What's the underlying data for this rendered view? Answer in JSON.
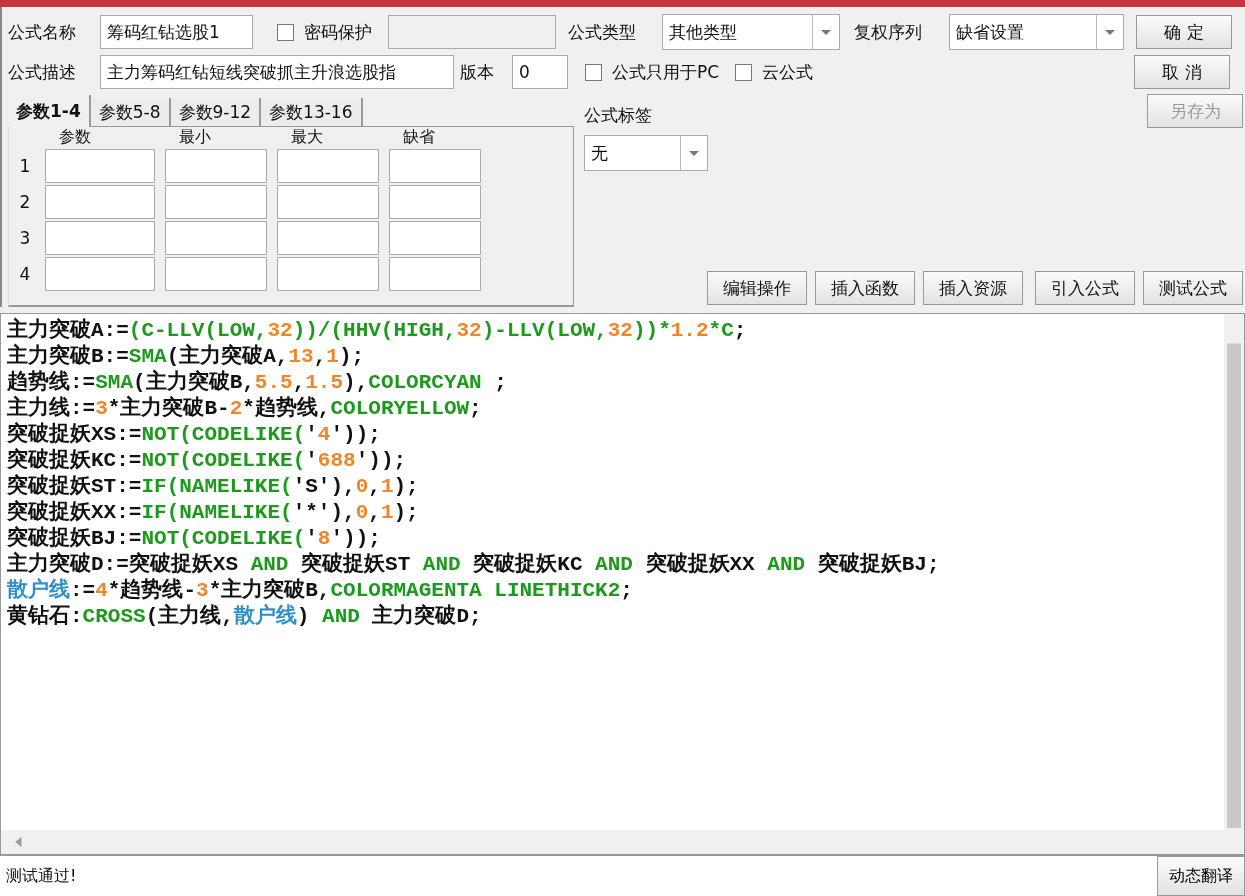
{
  "form": {
    "name_label": "公式名称",
    "name_value": "筹码红钻选股1",
    "password": {
      "label": "密码保护",
      "checked": false
    },
    "password_field": {
      "disabled": true
    },
    "desc_label": "公式描述",
    "desc_value": "主力筹码红钻短线突破抓主升浪选股指",
    "version_label": "版本",
    "version_value": "0",
    "type_label": "公式类型",
    "type_value": "其他类型",
    "rights_label": "复权序列",
    "rights_value": "缺省设置",
    "options": [
      {
        "label": "公式只用于PC",
        "checked": false
      },
      {
        "label": "云公式",
        "checked": false
      }
    ],
    "tag_label": "公式标签",
    "tag_value": "无"
  },
  "side_buttons": [
    {
      "label": "确 定",
      "disabled": false
    },
    {
      "label": "取 消",
      "disabled": false
    },
    {
      "label": "另存为",
      "disabled": true
    }
  ],
  "tabs": [
    {
      "label": "参数1-4",
      "selected": true
    },
    {
      "label": "参数5-8",
      "selected": false
    },
    {
      "label": "参数9-12",
      "selected": false
    },
    {
      "label": "参数13-16",
      "selected": false
    }
  ],
  "params": {
    "columns": [
      "参数",
      "最小",
      "最大",
      "缺省"
    ],
    "rows": [
      "1",
      "2",
      "3",
      "4"
    ]
  },
  "tool_buttons": [
    "编辑操作",
    "插入函数",
    "插入资源",
    "引入公式",
    "测试公式"
  ],
  "code": {
    "lines": [
      [
        {
          "text": "主力突破A:=",
          "kind": "text"
        },
        {
          "text": "(C-LLV(LOW,",
          "kind": "func"
        },
        {
          "text": "32",
          "kind": "num"
        },
        {
          "text": "))/(HHV(HIGH,",
          "kind": "func"
        },
        {
          "text": "32",
          "kind": "num"
        },
        {
          "text": ")-LLV(LOW,",
          "kind": "func"
        },
        {
          "text": "32",
          "kind": "num"
        },
        {
          "text": "))*",
          "kind": "func"
        },
        {
          "text": "1.2",
          "kind": "num"
        },
        {
          "text": "*C",
          "kind": "func"
        },
        {
          "text": ";",
          "kind": "text"
        }
      ],
      [
        {
          "text": "主力突破B:=",
          "kind": "text"
        },
        {
          "text": "SMA",
          "kind": "func"
        },
        {
          "text": "(主力突破A,",
          "kind": "text"
        },
        {
          "text": "13",
          "kind": "num"
        },
        {
          "text": ",",
          "kind": "text"
        },
        {
          "text": "1",
          "kind": "num"
        },
        {
          "text": ");",
          "kind": "text"
        }
      ],
      [
        {
          "text": "趋势线:=",
          "kind": "text"
        },
        {
          "text": "SMA",
          "kind": "func"
        },
        {
          "text": "(主力突破B,",
          "kind": "text"
        },
        {
          "text": "5.5",
          "kind": "num"
        },
        {
          "text": ",",
          "kind": "text"
        },
        {
          "text": "1.5",
          "kind": "num"
        },
        {
          "text": "),",
          "kind": "text"
        },
        {
          "text": "COLORCYAN",
          "kind": "func"
        },
        {
          "text": " ;",
          "kind": "text"
        }
      ],
      [
        {
          "text": "主力线:=",
          "kind": "text"
        },
        {
          "text": "3",
          "kind": "num"
        },
        {
          "text": "*主力突破B-",
          "kind": "text"
        },
        {
          "text": "2",
          "kind": "num"
        },
        {
          "text": "*趋势线,",
          "kind": "text"
        },
        {
          "text": "COLORYELLOW",
          "kind": "func"
        },
        {
          "text": ";",
          "kind": "text"
        }
      ],
      [
        {
          "text": "突破捉妖XS:=",
          "kind": "text"
        },
        {
          "text": "NOT(CODELIKE(",
          "kind": "func"
        },
        {
          "text": "'",
          "kind": "text"
        },
        {
          "text": "4",
          "kind": "num"
        },
        {
          "text": "'));",
          "kind": "text"
        }
      ],
      [
        {
          "text": "突破捉妖KC:=",
          "kind": "text"
        },
        {
          "text": "NOT(CODELIKE(",
          "kind": "func"
        },
        {
          "text": "'",
          "kind": "text"
        },
        {
          "text": "688",
          "kind": "num"
        },
        {
          "text": "'));",
          "kind": "text"
        }
      ],
      [
        {
          "text": "突破捉妖ST:=",
          "kind": "text"
        },
        {
          "text": "IF(NAMELIKE(",
          "kind": "func"
        },
        {
          "text": "'S'),",
          "kind": "text"
        },
        {
          "text": "0",
          "kind": "num"
        },
        {
          "text": ",",
          "kind": "text"
        },
        {
          "text": "1",
          "kind": "num"
        },
        {
          "text": ");",
          "kind": "text"
        }
      ],
      [
        {
          "text": "突破捉妖XX:=",
          "kind": "text"
        },
        {
          "text": "IF(NAMELIKE(",
          "kind": "func"
        },
        {
          "text": "'*'),",
          "kind": "text"
        },
        {
          "text": "0",
          "kind": "num"
        },
        {
          "text": ",",
          "kind": "text"
        },
        {
          "text": "1",
          "kind": "num"
        },
        {
          "text": ");",
          "kind": "text"
        }
      ],
      [
        {
          "text": "突破捉妖BJ:=",
          "kind": "text"
        },
        {
          "text": "NOT(CODELIKE(",
          "kind": "func"
        },
        {
          "text": "'",
          "kind": "text"
        },
        {
          "text": "8",
          "kind": "num"
        },
        {
          "text": "'));",
          "kind": "text"
        }
      ],
      [
        {
          "text": "主力突破D:=突破捉妖XS ",
          "kind": "text"
        },
        {
          "text": "AND",
          "kind": "func"
        },
        {
          "text": " 突破捉妖ST ",
          "kind": "text"
        },
        {
          "text": "AND",
          "kind": "func"
        },
        {
          "text": " 突破捉妖KC ",
          "kind": "text"
        },
        {
          "text": "AND",
          "kind": "func"
        },
        {
          "text": " 突破捉妖XX ",
          "kind": "text"
        },
        {
          "text": "AND",
          "kind": "func"
        },
        {
          "text": " 突破捉妖BJ;",
          "kind": "text"
        }
      ],
      [
        {
          "text": "散户线",
          "kind": "var"
        },
        {
          "text": ":=",
          "kind": "text"
        },
        {
          "text": "4",
          "kind": "num"
        },
        {
          "text": "*趋势线-",
          "kind": "text"
        },
        {
          "text": "3",
          "kind": "num"
        },
        {
          "text": "*主力突破B,",
          "kind": "text"
        },
        {
          "text": "COLORMAGENTA LINETHICK2",
          "kind": "func"
        },
        {
          "text": ";",
          "kind": "text"
        }
      ],
      [
        {
          "text": "黄钻石:",
          "kind": "text"
        },
        {
          "text": "CROSS",
          "kind": "func"
        },
        {
          "text": "(主力线,",
          "kind": "text"
        },
        {
          "text": "散户线",
          "kind": "var"
        },
        {
          "text": ") ",
          "kind": "text"
        },
        {
          "text": "AND",
          "kind": "func"
        },
        {
          "text": " 主力突破D;",
          "kind": "text"
        }
      ]
    ]
  },
  "status_bar": {
    "message": "测试通过!",
    "button": "动态翻译"
  }
}
